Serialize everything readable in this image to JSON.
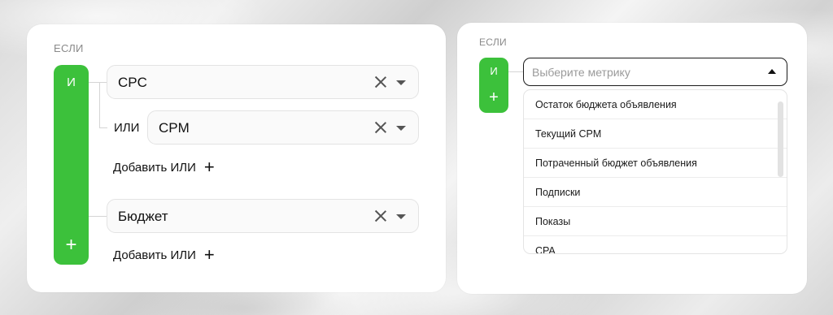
{
  "left": {
    "if_label": "ЕСЛИ",
    "and_label": "И",
    "row1": {
      "value": "CPC"
    },
    "or_label": "ИЛИ",
    "row2": {
      "value": "CPM"
    },
    "add_or_1": "Добавить ИЛИ",
    "row3": {
      "value": "Бюджет"
    },
    "add_or_2": "Добавить ИЛИ",
    "plus": "+"
  },
  "right": {
    "if_label": "ЕСЛИ",
    "and_label": "И",
    "plus": "+",
    "metric_placeholder": "Выберите метрику",
    "options": [
      "Остаток бюджета объявления",
      "Текущий CPM",
      "Потраченный бюджет объявления",
      "Подписки",
      "Показы",
      "CPA"
    ]
  },
  "colors": {
    "accent": "#3cc13b",
    "border": "#e3e3e3"
  },
  "icons": [
    "clear-icon",
    "chevron-down-icon",
    "chevron-up-icon",
    "plus-icon"
  ]
}
